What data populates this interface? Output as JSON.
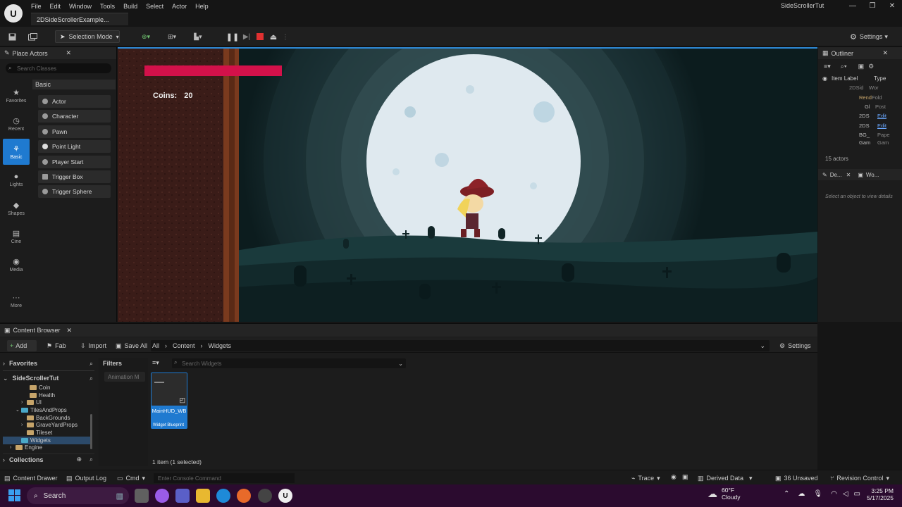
{
  "menu": [
    "File",
    "Edit",
    "Window",
    "Tools",
    "Build",
    "Select",
    "Actor",
    "Help"
  ],
  "project_tab": "2DSideScrollerExample...",
  "window_title": "SideScrollerTut",
  "toolbar": {
    "selection_mode": "Selection Mode",
    "settings": "Settings"
  },
  "place_actors": {
    "title": "Place Actors",
    "search_placeholder": "Search Classes",
    "categories": [
      "Favorites",
      "Recent",
      "Basic",
      "Lights",
      "Shapes",
      "Cine",
      "Media",
      "More"
    ],
    "section": "Basic",
    "items": [
      "Actor",
      "Character",
      "Pawn",
      "Point Light",
      "Player Start",
      "Trigger Box",
      "Trigger Sphere"
    ]
  },
  "viewport": {
    "coins_label": "Coins:",
    "coins_value": "20",
    "health_fraction": 1.0,
    "health_color": "#d3114a"
  },
  "outliner": {
    "title": "Outliner",
    "col_label": "Item Label",
    "col_type": "Type",
    "rows": [
      {
        "label": "2DSid",
        "type": "Wor"
      },
      {
        "label": "Rend",
        "type": "Fold"
      },
      {
        "label": "Gl",
        "type": "Post"
      },
      {
        "label": "2DS",
        "type": "Edit"
      },
      {
        "label": "2DS",
        "type": "Edit"
      },
      {
        "label": "BG_",
        "type": "Pape"
      },
      {
        "label": "Gam",
        "type": "Gam"
      }
    ],
    "count": "15 actors",
    "details_tab": "De...",
    "world_tab": "Wo...",
    "details_hint": "Select an object to view details"
  },
  "content_browser": {
    "title": "Content Browser",
    "add": "Add",
    "fab": "Fab",
    "import": "Import",
    "save_all": "Save All",
    "path": [
      "All",
      "Content",
      "Widgets"
    ],
    "settings": "Settings",
    "favorites": "Favorites",
    "project": "SideScrollerTut",
    "tree": [
      "Coin",
      "Health",
      "UI",
      "TilesAndProps",
      "BackGrounds",
      "GraveYardProps",
      "Tileset",
      "Widgets",
      "Engine"
    ],
    "collections": "Collections",
    "filters": "Filters",
    "filter_chip": "Animation M",
    "search_placeholder": "Search Widgets",
    "asset_name": "MainHUD_WB",
    "asset_type": "Widget Blueprint",
    "count": "1 item (1 selected)"
  },
  "status": {
    "content_drawer": "Content Drawer",
    "output_log": "Output Log",
    "cmd": "Cmd",
    "console_placeholder": "Enter Console Command",
    "trace": "Trace",
    "derived_data": "Derived Data",
    "unsaved": "36 Unsaved",
    "revision": "Revision Control"
  },
  "taskbar": {
    "search": "Search",
    "weather_temp": "60°F",
    "weather_desc": "Cloudy",
    "time": "3:25 PM",
    "date": "5/17/2025"
  }
}
